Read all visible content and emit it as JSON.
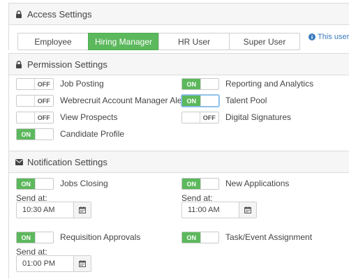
{
  "access": {
    "title": "Access Settings",
    "tabs": [
      {
        "label": "Employee",
        "active": false
      },
      {
        "label": "Hiring Manager",
        "active": true
      },
      {
        "label": "HR User",
        "active": false
      },
      {
        "label": "Super User",
        "active": false
      }
    ],
    "info_text": "This user l"
  },
  "permission": {
    "title": "Permission Settings",
    "items": [
      {
        "label": "Job Posting",
        "state": "OFF"
      },
      {
        "label": "Reporting and Analytics",
        "state": "ON"
      },
      {
        "label": "Webrecruit Account Manager Alert",
        "state": "OFF"
      },
      {
        "label": "Talent Pool",
        "state": "ON"
      },
      {
        "label": "View Prospects",
        "state": "OFF"
      },
      {
        "label": "Digital Signatures",
        "state": "OFF"
      },
      {
        "label": "Candidate Profile",
        "state": "ON"
      }
    ]
  },
  "notification": {
    "title": "Notification Settings",
    "send_at_label": "Send at:",
    "items": [
      {
        "label": "Jobs Closing",
        "state": "ON",
        "time": "10:30 AM"
      },
      {
        "label": "New Applications",
        "state": "ON",
        "time": "11:00 AM"
      },
      {
        "label": "Requisition Approvals",
        "state": "ON",
        "time": "01:00 PM"
      },
      {
        "label": "Task/Event Assignment",
        "state": "ON"
      }
    ]
  },
  "colors": {
    "accent_green": "#5cb85c",
    "info_blue": "#3a7bbd",
    "header_bg": "#f6f6f6"
  }
}
